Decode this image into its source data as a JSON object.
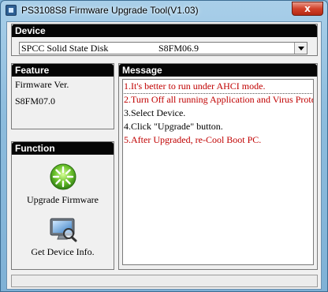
{
  "window": {
    "title": "PS3108S8 Firmware Upgrade Tool(V1.03)",
    "close_label": "x"
  },
  "device": {
    "header": "Device",
    "selected_name": "SPCC Solid State Disk",
    "selected_fw": "S8FM06.9"
  },
  "feature": {
    "header": "Feature",
    "label": "Firmware Ver.",
    "value": "S8FM07.0"
  },
  "function": {
    "header": "Function",
    "upgrade_label": "Upgrade Firmware",
    "info_label": "Get Device Info."
  },
  "message": {
    "header": "Message",
    "lines": [
      {
        "text": "1.It's better to run under AHCI mode.",
        "color": "#c00000"
      },
      {
        "text": "2.Turn Off all running Application and Virus Prote",
        "color": "#c00000"
      },
      {
        "text": "3.Select Device.",
        "color": "#000000"
      },
      {
        "text": "4.Click \"Upgrade\" button.",
        "color": "#000000"
      },
      {
        "text": "5.After Upgraded, re-Cool Boot PC.",
        "color": "#c00000"
      }
    ]
  },
  "colors": {
    "header_bg": "#050505",
    "warning_text": "#c00000",
    "close_button": "#d2412a"
  },
  "icons": {
    "upgrade": "green-burst-icon",
    "info": "monitor-magnifier-icon",
    "app": "app-window-icon",
    "close": "close-icon",
    "dropdown": "chevron-down-icon"
  }
}
